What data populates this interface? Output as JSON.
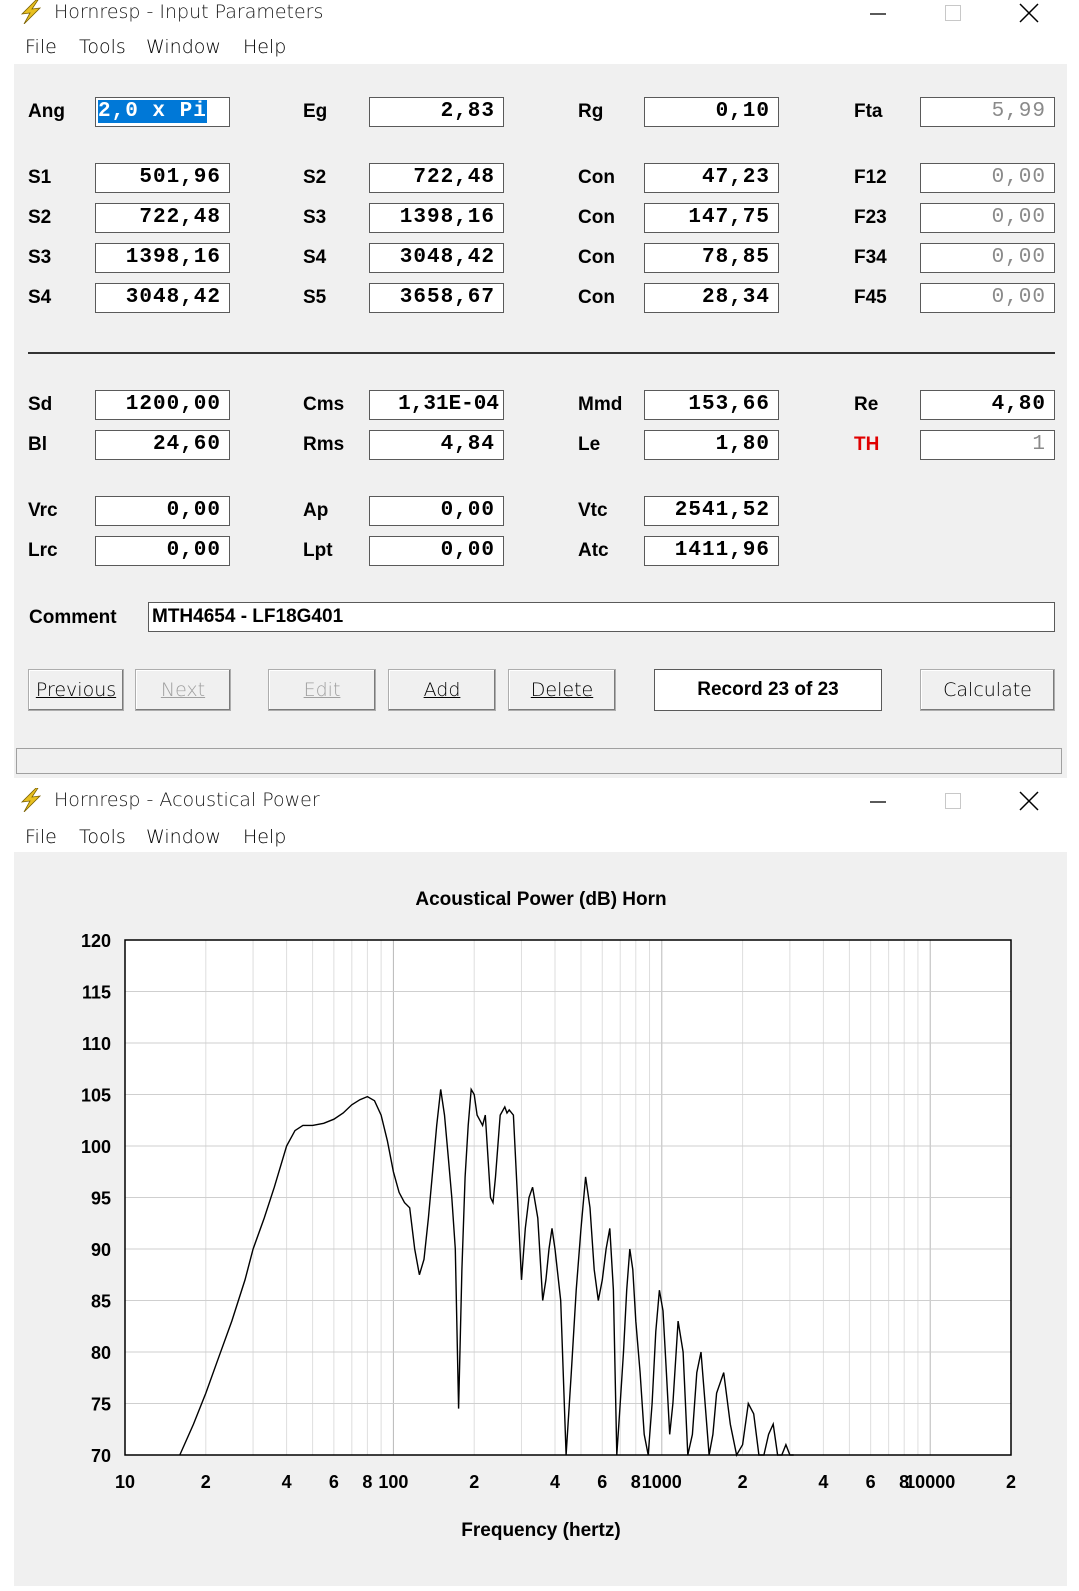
{
  "window1": {
    "title": "Hornresp - Input Parameters",
    "menu": [
      "File",
      "Tools",
      "Window",
      "Help"
    ]
  },
  "params": {
    "Ang": "2,0 x Pi",
    "Eg": "2,83",
    "Rg": "0,10",
    "Fta": "5,99",
    "rows": [
      [
        "S1",
        "501,96",
        "S2",
        "722,48",
        "Con",
        "47,23",
        "F12",
        "0,00"
      ],
      [
        "S2",
        "722,48",
        "S3",
        "1398,16",
        "Con",
        "147,75",
        "F23",
        "0,00"
      ],
      [
        "S3",
        "1398,16",
        "S4",
        "3048,42",
        "Con",
        "78,85",
        "F34",
        "0,00"
      ],
      [
        "S4",
        "3048,42",
        "S5",
        "3658,67",
        "Con",
        "28,34",
        "F45",
        "0,00"
      ]
    ],
    "Sd": "1200,00",
    "Cms": "1,31E-04",
    "Mmd": "153,66",
    "Re": "4,80",
    "Bl": "24,60",
    "Rms": "4,84",
    "Le": "1,80",
    "TH": "1",
    "Vrc": "0,00",
    "Ap": "0,00",
    "Vtc": "2541,52",
    "Lrc": "0,00",
    "Lpt": "0,00",
    "Atc": "1411,96",
    "labels": {
      "Ang": "Ang",
      "Eg": "Eg",
      "Rg": "Rg",
      "Fta": "Fta",
      "Sd": "Sd",
      "Cms": "Cms",
      "Mmd": "Mmd",
      "Re": "Re",
      "Bl": "Bl",
      "Rms": "Rms",
      "Le": "Le",
      "TH": "TH",
      "Vrc": "Vrc",
      "Ap": "Ap",
      "Vtc": "Vtc",
      "Lrc": "Lrc",
      "Lpt": "Lpt",
      "Atc": "Atc",
      "Comment": "Comment"
    },
    "comment": "MTH4654 - LF18G401"
  },
  "buttons": {
    "previous": "Previous",
    "next": "Next",
    "edit": "Edit",
    "add": "Add",
    "delete": "Delete",
    "record": "Record 23 of 23",
    "calculate": "Calculate"
  },
  "colors": {
    "panel": "#f0f0f0",
    "selection": "#0078d7",
    "th_label": "#e00000"
  },
  "window2": {
    "title": "Hornresp - Acoustical Power",
    "menu": [
      "File",
      "Tools",
      "Window",
      "Help"
    ]
  },
  "chart_data": {
    "type": "line",
    "title": "Acoustical Power (dB)   Horn",
    "xlabel": "Frequency (hertz)",
    "ylabel": "",
    "xscale": "log",
    "xlim": [
      10,
      20000
    ],
    "ylim": [
      70,
      120
    ],
    "yticks": [
      70,
      75,
      80,
      85,
      90,
      95,
      100,
      105,
      110,
      115,
      120
    ],
    "xtick_labels": [
      {
        "v": 10,
        "t": "10"
      },
      {
        "v": 20,
        "t": "2"
      },
      {
        "v": 40,
        "t": "4"
      },
      {
        "v": 60,
        "t": "6"
      },
      {
        "v": 80,
        "t": "8"
      },
      {
        "v": 100,
        "t": "100"
      },
      {
        "v": 200,
        "t": "2"
      },
      {
        "v": 400,
        "t": "4"
      },
      {
        "v": 600,
        "t": "6"
      },
      {
        "v": 800,
        "t": "8"
      },
      {
        "v": 1000,
        "t": "1000"
      },
      {
        "v": 2000,
        "t": "2"
      },
      {
        "v": 4000,
        "t": "4"
      },
      {
        "v": 6000,
        "t": "6"
      },
      {
        "v": 8000,
        "t": "8"
      },
      {
        "v": 10000,
        "t": "10000"
      },
      {
        "v": 20000,
        "t": "2"
      }
    ],
    "grid": true,
    "series": [
      {
        "name": "",
        "x": [
          16,
          18,
          20,
          22,
          25,
          28,
          30,
          33,
          36,
          40,
          43,
          46,
          50,
          55,
          60,
          65,
          70,
          75,
          80,
          85,
          90,
          95,
          100,
          105,
          110,
          115,
          120,
          125,
          130,
          135,
          140,
          145,
          150,
          155,
          160,
          165,
          170,
          175,
          180,
          185,
          190,
          195,
          200,
          205,
          210,
          215,
          220,
          225,
          230,
          235,
          240,
          250,
          260,
          265,
          270,
          280,
          290,
          300,
          310,
          320,
          330,
          345,
          360,
          370,
          380,
          390,
          400,
          420,
          440,
          460,
          480,
          500,
          520,
          540,
          560,
          580,
          600,
          620,
          640,
          660,
          680,
          700,
          720,
          740,
          760,
          780,
          800,
          830,
          860,
          890,
          920,
          950,
          980,
          1010,
          1040,
          1070,
          1100,
          1150,
          1200,
          1250,
          1300,
          1350,
          1400,
          1450,
          1500,
          1550,
          1600,
          1700,
          1800,
          1900,
          2000,
          2100,
          2200,
          2300,
          2400,
          2500,
          2600,
          2700,
          2800,
          2900,
          3000,
          3100
        ],
        "y": [
          70,
          73,
          76,
          79,
          83,
          87,
          90,
          93,
          96,
          100,
          101.5,
          102,
          102,
          102.2,
          102.6,
          103.2,
          104,
          104.5,
          104.8,
          104.4,
          103,
          100.5,
          97.5,
          95.5,
          94.5,
          94,
          90,
          87.5,
          89,
          93,
          97.5,
          102,
          105.5,
          103,
          99,
          95,
          90,
          74.5,
          88,
          97,
          102,
          105.5,
          105,
          103,
          102.5,
          102,
          103,
          99,
          95,
          94.5,
          97,
          103,
          103.8,
          103.2,
          103.5,
          103,
          95,
          87,
          92,
          95,
          96,
          93,
          85,
          87,
          90,
          92,
          90,
          85,
          70,
          78,
          86,
          92,
          97,
          94,
          88,
          85,
          87,
          90,
          92,
          86,
          70,
          75,
          80,
          86,
          90,
          88,
          83,
          78,
          72,
          70,
          75,
          82,
          86,
          84,
          78,
          72,
          75,
          83,
          80,
          70,
          72,
          78,
          80,
          75,
          70,
          72,
          76,
          78,
          73,
          70,
          71,
          75,
          74,
          70,
          70,
          72,
          73,
          70,
          70,
          71,
          70,
          70
        ]
      }
    ]
  }
}
